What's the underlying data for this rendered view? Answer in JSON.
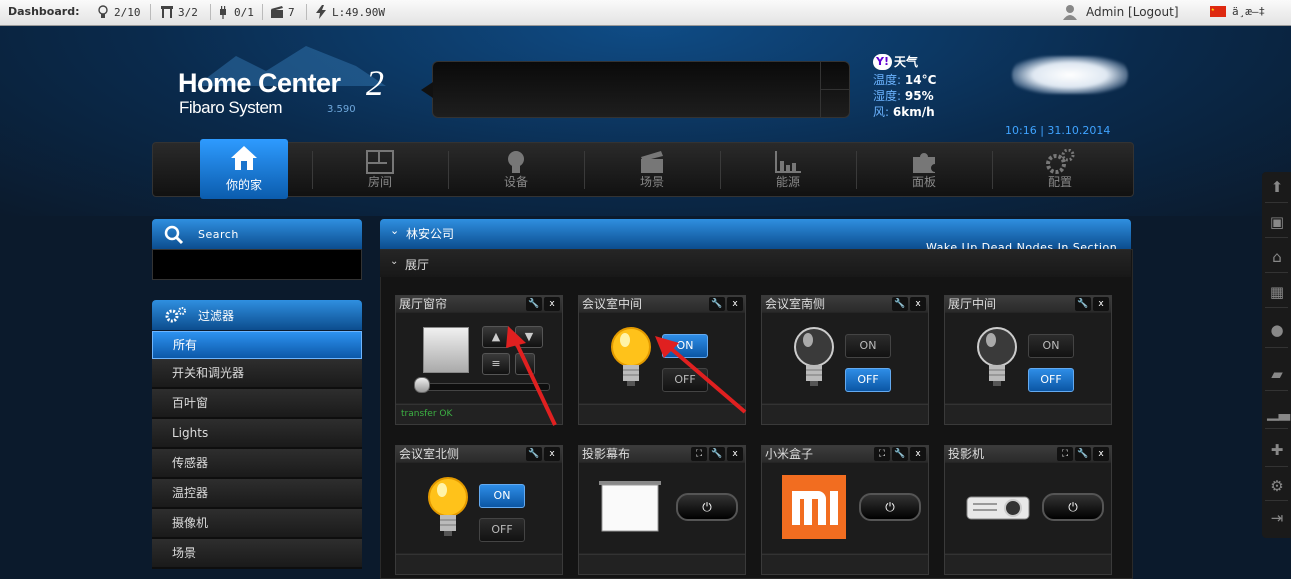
{
  "topbar": {
    "dashboard_label": "Dashboard:",
    "stats": [
      {
        "icon": "lightbulb-icon",
        "value": "2/10"
      },
      {
        "icon": "blind-icon",
        "value": "3/2"
      },
      {
        "icon": "plug-icon",
        "value": "0/1"
      },
      {
        "icon": "clapper-icon",
        "value": "7"
      },
      {
        "icon": "lightning-icon",
        "value": "L:49.90W"
      }
    ],
    "user": "Admin [Logout]",
    "language": "ä¸­æ–‡",
    "colors": {
      "bar": "#efefef",
      "text": "#333333"
    }
  },
  "header": {
    "logo_title": "Home Center",
    "logo_two": "2",
    "logo_sub": "Fibaro System",
    "version": "3.590",
    "weather": {
      "provider_mark": "Y!",
      "title": "天气",
      "temp_label": "温度:",
      "temp_value": "14°C",
      "humidity_label": "湿度:",
      "humidity_value": "95%",
      "wind_label": "风:",
      "wind_value": "6km/h",
      "icon": "cloud-icon"
    },
    "datetime": "10:16 | 31.10.2014"
  },
  "nav": {
    "items": [
      {
        "label": "你的家",
        "icon": "house-icon",
        "active": true
      },
      {
        "label": "房间",
        "icon": "floorplan-icon"
      },
      {
        "label": "设备",
        "icon": "bulb-icon"
      },
      {
        "label": "场景",
        "icon": "clapper-icon"
      },
      {
        "label": "能源",
        "icon": "bar-chart-icon"
      },
      {
        "label": "面板",
        "icon": "puzzle-icon"
      },
      {
        "label": "配置",
        "icon": "gears-icon"
      }
    ]
  },
  "sidebar": {
    "search_label": "Search",
    "filter_label": "过滤器",
    "filters": [
      "所有",
      "开关和调光器",
      "百叶窗",
      "Lights",
      "传感器",
      "温控器",
      "摄像机",
      "场景"
    ]
  },
  "section": {
    "title": "林安公司",
    "wake_label": "Wake Up Dead Nodes In Section",
    "room_title": "展厅"
  },
  "devices": [
    {
      "name": "展厅窗帘",
      "type": "blind",
      "status": "transfer OK",
      "level": 0
    },
    {
      "name": "会议室中间",
      "type": "light",
      "on_label": "ON",
      "off_label": "OFF",
      "state": "on"
    },
    {
      "name": "会议室南侧",
      "type": "light",
      "on_label": "ON",
      "off_label": "OFF",
      "state": "off"
    },
    {
      "name": "展厅中间",
      "type": "light",
      "on_label": "ON",
      "off_label": "OFF",
      "state": "off"
    },
    {
      "name": "会议室北侧",
      "type": "light",
      "on_label": "ON",
      "off_label": "OFF",
      "state": "on"
    },
    {
      "name": "投影幕布",
      "type": "screen",
      "power_label": "⏻"
    },
    {
      "name": "小米盒子",
      "type": "mi-box",
      "power_label": "⏻",
      "logo_text": "mi"
    },
    {
      "name": "投影机",
      "type": "projector",
      "power_label": "⏻"
    }
  ],
  "colors": {
    "accent": "#1e7fd8",
    "background": "#0b1a2c",
    "annotation_arrow": "#e02020",
    "bulb_on": "#ffc21a",
    "mi_orange": "#f26d20"
  }
}
